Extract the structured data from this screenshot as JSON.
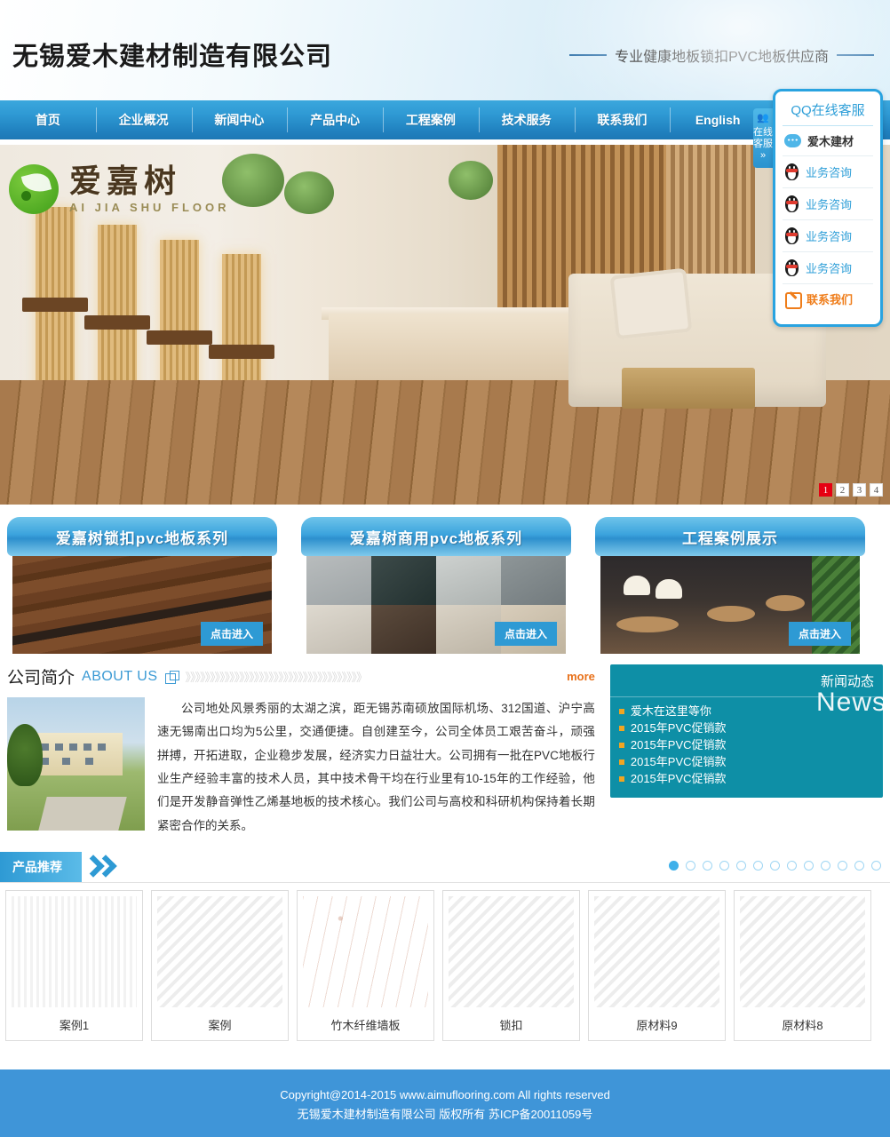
{
  "header": {
    "company_title": "无锡爱木建材制造有限公司",
    "tagline": "专业健康地板锁扣PVC地板供应商"
  },
  "nav": {
    "items": [
      {
        "label": "首页"
      },
      {
        "label": "企业概况"
      },
      {
        "label": "新闻中心"
      },
      {
        "label": "产品中心"
      },
      {
        "label": "工程案例"
      },
      {
        "label": "技术服务"
      },
      {
        "label": "联系我们"
      },
      {
        "label": "English"
      }
    ]
  },
  "qq": {
    "title": "QQ在线客服",
    "rows": [
      {
        "label": "爱木建材",
        "icon": "chat-bubble-icon"
      },
      {
        "label": "业务咨询",
        "icon": "qq-penguin-icon"
      },
      {
        "label": "业务咨询",
        "icon": "qq-penguin-icon"
      },
      {
        "label": "业务咨询",
        "icon": "qq-penguin-icon"
      },
      {
        "label": "业务咨询",
        "icon": "qq-penguin-icon"
      },
      {
        "label": "联系我们",
        "icon": "pencil-icon"
      }
    ],
    "tab_icon": "people-icon",
    "tab_text": "在线客服",
    "tab_arrow": "»"
  },
  "slider": {
    "logo_cn": "爱嘉树",
    "logo_en": "AI JIA SHU FLOOR",
    "pages": [
      "1",
      "2",
      "3",
      "4"
    ],
    "active_page": "1"
  },
  "categories": [
    {
      "title": "爱嘉树锁扣pvc地板系列",
      "button": "点击进入"
    },
    {
      "title": "爱嘉树商用pvc地板系列",
      "button": "点击进入"
    },
    {
      "title": "工程案例展示",
      "button": "点击进入"
    }
  ],
  "about": {
    "title_cn": "公司简介",
    "title_en": "ABOUT US",
    "chevrons": "》》》》》》》》》》》》》》》》》》》》》》》》》》》》》》》》》》》》",
    "more": "more",
    "body": "公司地处风景秀丽的太湖之滨，距无锡苏南硕放国际机场、312国道、沪宁高速无锡南出口均为5公里，交通便捷。自创建至今，公司全体员工艰苦奋斗，顽强拼搏，开拓进取，企业稳步发展，经济实力日益壮大。公司拥有一批在PVC地板行业生产经验丰富的技术人员，其中技术骨干均在行业里有10-15年的工作经验，他们是开发静音弹性乙烯基地板的技术核心。我们公司与高校和科研机构保持着长期紧密合作的关系。"
  },
  "news": {
    "title": "新闻动态",
    "watermark": "News",
    "items": [
      {
        "label": "爱木在这里等你"
      },
      {
        "label": "2015年PVC促销款"
      },
      {
        "label": "2015年PVC促销款"
      },
      {
        "label": "2015年PVC促销款"
      },
      {
        "label": "2015年PVC促销款"
      }
    ]
  },
  "products": {
    "section_title": "产品推荐",
    "dots_count": 13,
    "active_dot": 1,
    "items": [
      {
        "caption": "案例1"
      },
      {
        "caption": "案例"
      },
      {
        "caption": "竹木纤维墙板"
      },
      {
        "caption": "锁扣"
      },
      {
        "caption": "原材料9"
      },
      {
        "caption": "原材料8"
      }
    ]
  },
  "footer": {
    "line1": "Copyright@2014-2015 www.aimuflooring.com All rights reserved",
    "line2": "无锡爱木建材制造有限公司 版权所有 苏ICP备20011059号"
  },
  "colors": {
    "nav_blue": "#2f9ad4",
    "news_teal": "#0e8fa6",
    "footer_blue": "#3f95d8",
    "accent_orange": "#e8711a",
    "active_red": "#e60012"
  }
}
